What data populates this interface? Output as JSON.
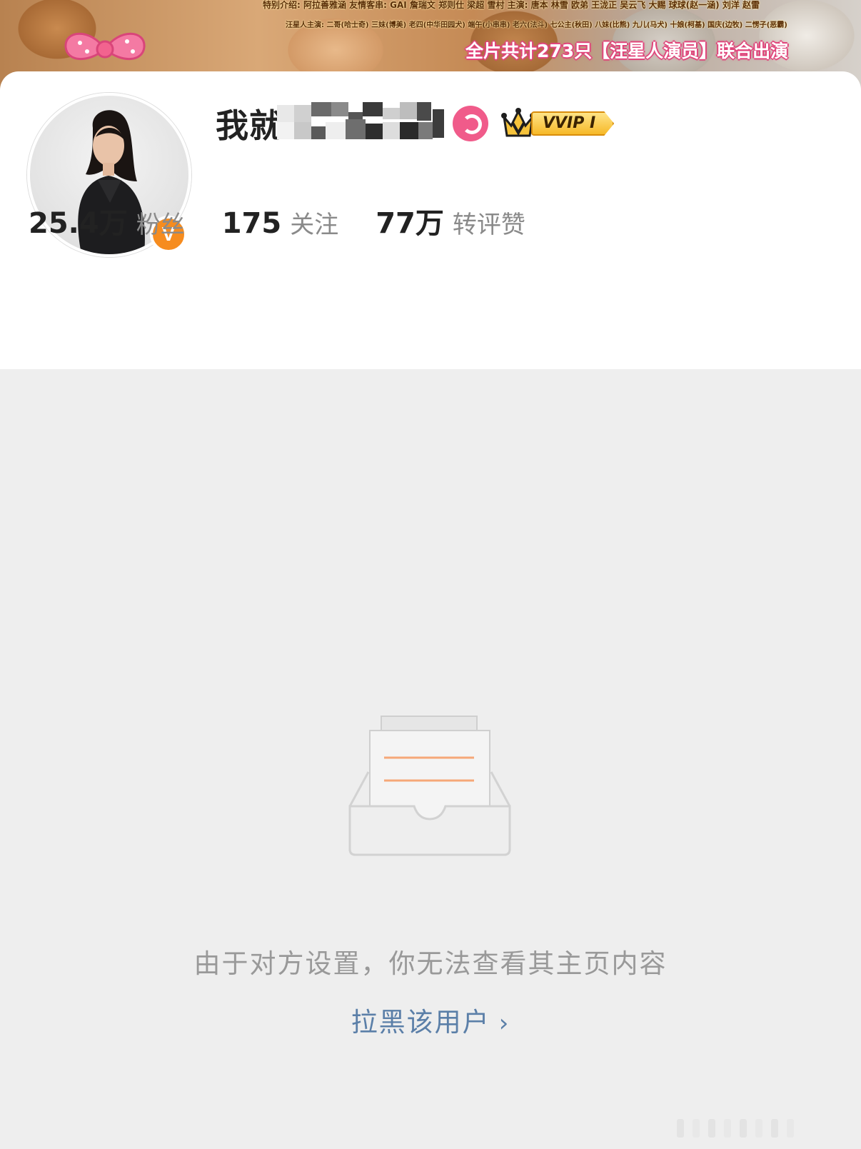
{
  "banner": {
    "line1": "特别介绍: 阿拉善雅涵 友情客串: GAI 詹瑞文 郑则仕 梁超 雪村 主演: 唐本 林雪 欧弟 王泷正 吴云飞 大赐 球球(赵一涵) 刘洋 赵雷",
    "line2": "汪星人主演: 二哥(哈士奇) 三妹(博美) 老四(中华田园犬) 端午(小串串) 老六(法斗) 七公主(秋田) 八妹(比熊) 九儿(马犬) 十娘(柯基) 国庆(边牧) 二愣子(恶霸)",
    "line3": "全片共计273只【汪星人演员】联合出演"
  },
  "profile": {
    "name_visible": "我就",
    "vip_label": "VVIP I",
    "verified_icon": "V"
  },
  "stats": [
    {
      "value": "25.4万",
      "label": "粉丝"
    },
    {
      "value": "175",
      "label": "关注"
    },
    {
      "value": "77万",
      "label": "转评赞"
    }
  ],
  "empty_state": {
    "message": "由于对方设置，你无法查看其主页内容",
    "block_link": "拉黑该用户",
    "chevron": "›"
  },
  "colors": {
    "accent_orange": "#f68c1f",
    "link_blue": "#5b7fa8",
    "badge_pink": "#f05b8a",
    "vip_gold": "#f6b928"
  }
}
